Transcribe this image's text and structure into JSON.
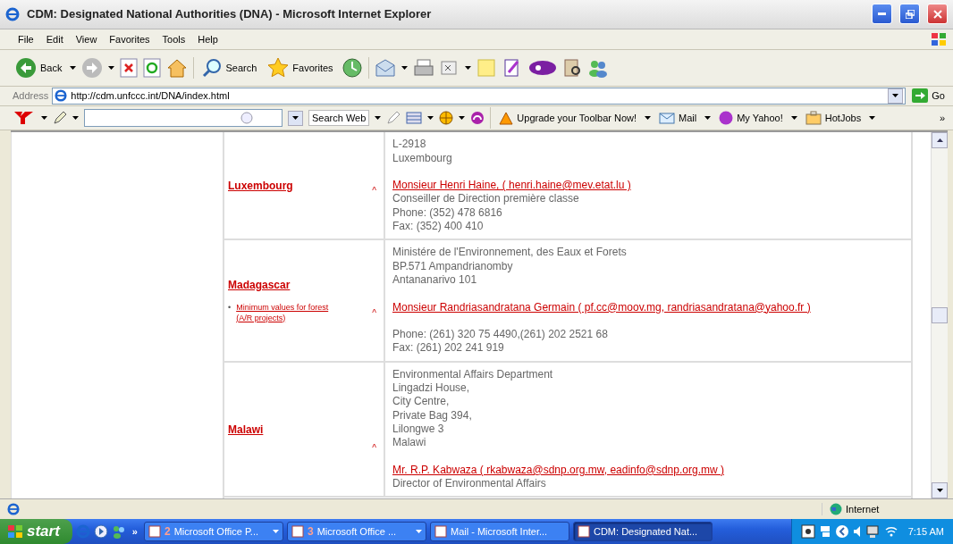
{
  "window": {
    "title": "CDM: Designated National Authorities (DNA) - Microsoft Internet Explorer"
  },
  "menu": [
    "File",
    "Edit",
    "View",
    "Favorites",
    "Tools",
    "Help"
  ],
  "toolbar": {
    "back": "Back",
    "search": "Search",
    "favorites": "Favorites"
  },
  "address": {
    "label": "Address",
    "url": "http://cdm.unfccc.int/DNA/index.html",
    "go": "Go"
  },
  "yahoo_toolbar": {
    "search_button": "Search Web",
    "upgrade": "Upgrade your Toolbar Now!",
    "mail": "Mail",
    "my_yahoo": "My Yahoo!",
    "hotjobs": "HotJobs",
    "more": "»"
  },
  "rows": [
    {
      "country": "Luxembourg",
      "caret": "^",
      "links": [],
      "lines": [
        {
          "kind": "text",
          "text": "L-2918"
        },
        {
          "kind": "text",
          "text": "Luxembourg"
        },
        {
          "kind": "blank"
        },
        {
          "kind": "link",
          "text": "Monsieur Henri Haine, ( henri.haine@mev.etat.lu )"
        },
        {
          "kind": "text",
          "text": "Conseiller de Direction première classe"
        },
        {
          "kind": "text",
          "text": "Phone: (352) 478 6816"
        },
        {
          "kind": "text",
          "text": "Fax: (352) 400 410"
        }
      ]
    },
    {
      "country": "Madagascar",
      "caret": "^",
      "links": [
        {
          "bullet": "•",
          "text": "Minimum values for forest (A/R projects)"
        }
      ],
      "lines": [
        {
          "kind": "text",
          "text": "Ministére de l'Environnement, des Eaux et Forets"
        },
        {
          "kind": "text",
          "text": "BP.571 Ampandrianomby"
        },
        {
          "kind": "text",
          "text": "Antananarivo 101"
        },
        {
          "kind": "blank"
        },
        {
          "kind": "link",
          "text": "Monsieur Randriasandratana Germain ( pf.cc@moov.mg, randriasandratana@yahoo.fr )"
        },
        {
          "kind": "blank"
        },
        {
          "kind": "text",
          "text": "Phone: (261) 320 75 4490,(261) 202 2521 68"
        },
        {
          "kind": "text",
          "text": "Fax: (261) 202 241 919"
        }
      ]
    },
    {
      "country": "Malawi",
      "caret": "^",
      "links": [],
      "lines": [
        {
          "kind": "text",
          "text": "Environmental Affairs Department"
        },
        {
          "kind": "text",
          "text": "Lingadzi House,"
        },
        {
          "kind": "text",
          "text": "City Centre,"
        },
        {
          "kind": "text",
          "text": "Private Bag 394,"
        },
        {
          "kind": "text",
          "text": "Lilongwe 3"
        },
        {
          "kind": "text",
          "text": "Malawi"
        },
        {
          "kind": "blank"
        },
        {
          "kind": "link",
          "text": "Mr. R.P. Kabwaza ( rkabwaza@sdnp.org.mw, eadinfo@sdnp.org.mw )"
        },
        {
          "kind": "text",
          "text": "Director of Environmental Affairs"
        }
      ]
    }
  ],
  "status_bar": {
    "zone": "Internet"
  },
  "taskbar": {
    "start": "start",
    "more": "»",
    "tasks": [
      {
        "count": "2",
        "label": "Microsoft Office P...",
        "menu": true,
        "selected": false
      },
      {
        "count": "3",
        "label": "Microsoft Office ...",
        "menu": true,
        "selected": false
      },
      {
        "label": "Mail - Microsoft Inter...",
        "menu": false,
        "selected": false
      },
      {
        "label": "CDM: Designated Nat...",
        "menu": false,
        "selected": true
      }
    ],
    "clock": "7:15 AM"
  }
}
